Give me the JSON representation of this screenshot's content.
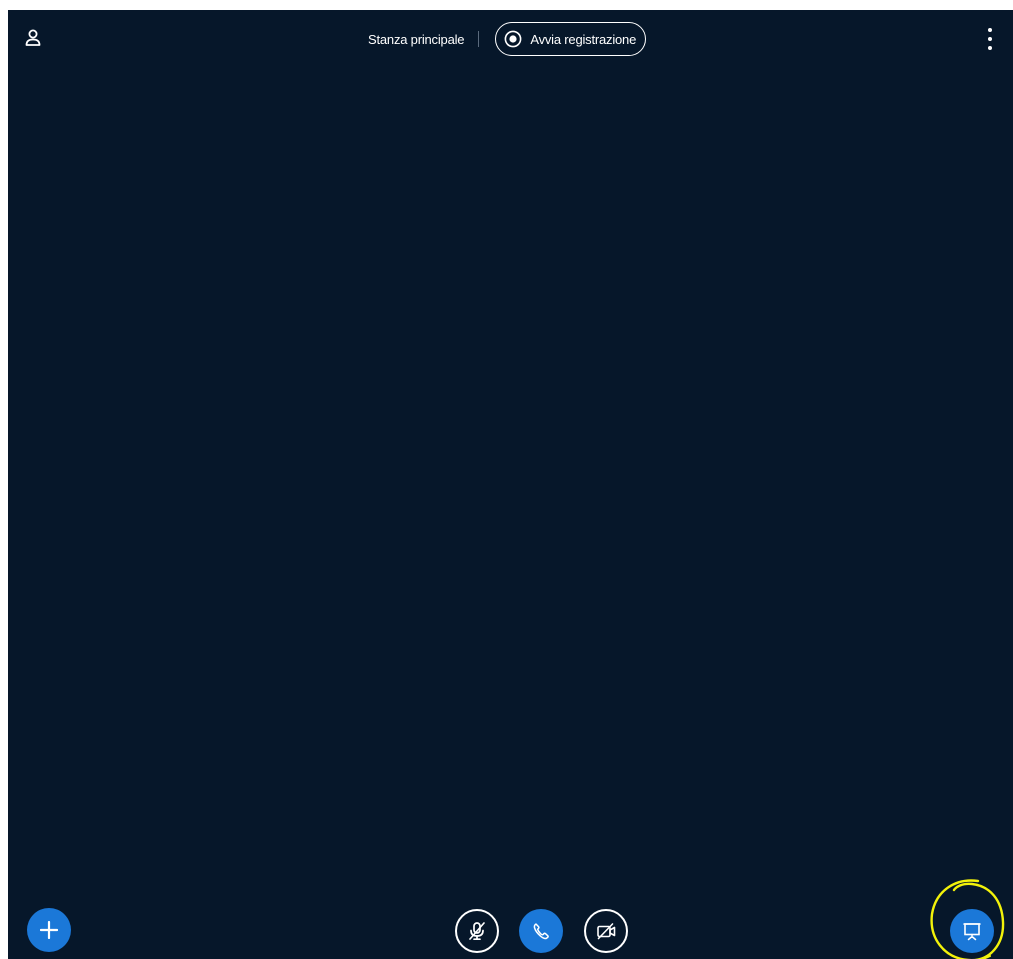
{
  "header": {
    "room_name": "Stanza principale",
    "record_label": "Avvia registrazione"
  },
  "icons": {
    "user": "user-icon",
    "record": "record-icon",
    "more": "more-vertical-icon",
    "plus": "plus-icon",
    "mic_muted": "mic-muted-icon",
    "phone": "phone-icon",
    "camera_off": "camera-off-icon",
    "presentation": "presentation-icon"
  },
  "colors": {
    "background": "#06172a",
    "accent": "#1b78d8",
    "highlight": "#f2f20a",
    "foreground": "#ffffff"
  }
}
